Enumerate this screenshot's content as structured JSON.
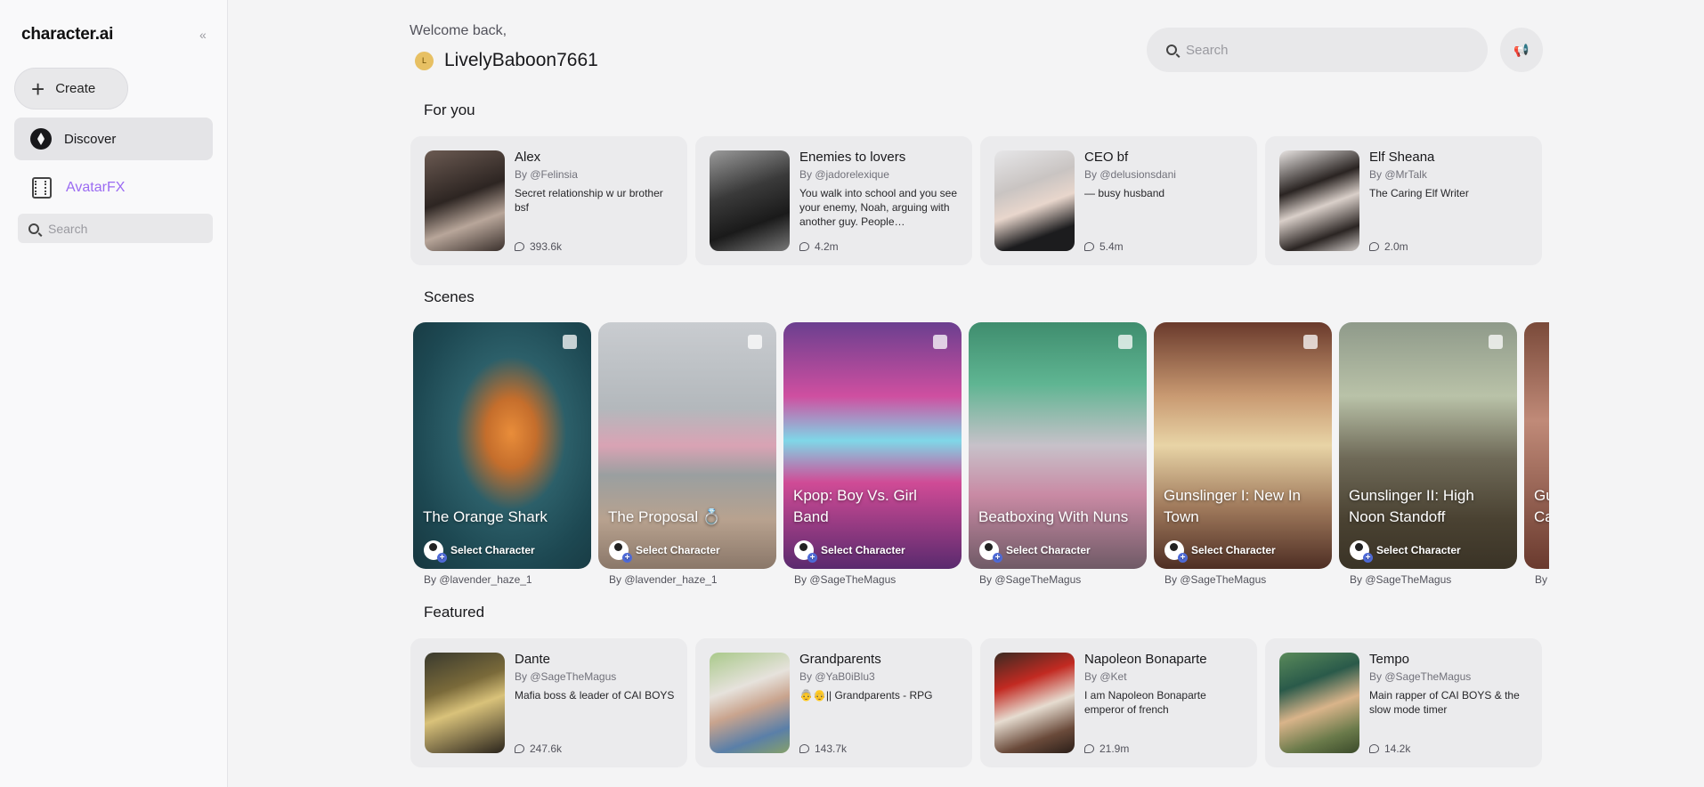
{
  "app": {
    "logo": "character.ai",
    "collapse_icon": "«"
  },
  "sidebar": {
    "create_label": "Create",
    "discover_label": "Discover",
    "avatarfx_label": "AvatarFX",
    "search_placeholder": "Search"
  },
  "header": {
    "welcome": "Welcome back,",
    "user_initial": "L",
    "username": "LivelyBaboon7661",
    "search_placeholder": "Search"
  },
  "sections": {
    "for_you": "For you",
    "scenes": "Scenes",
    "featured": "Featured"
  },
  "for_you": [
    {
      "name": "Alex",
      "by": "By @Felinsia",
      "desc": "Secret relationship w ur brother bsf",
      "count": "393.6k"
    },
    {
      "name": "Enemies to lovers",
      "by": "By @jadorelexique",
      "desc": "You walk into school and you see your enemy, Noah, arguing with another guy. People…",
      "count": "4.2m"
    },
    {
      "name": "CEO bf",
      "by": "By @delusionsdani",
      "desc": "— busy husband",
      "count": "5.4m"
    },
    {
      "name": "Elf Sheana",
      "by": "By @MrTalk",
      "desc": "The Caring Elf Writer",
      "count": "2.0m"
    }
  ],
  "scenes": [
    {
      "title": "The Orange Shark",
      "select": "Select Character",
      "by": "By @lavender_haze_1"
    },
    {
      "title": "The Proposal 💍",
      "select": "Select Character",
      "by": "By @lavender_haze_1"
    },
    {
      "title": "Kpop: Boy Vs. Girl Band",
      "select": "Select Character",
      "by": "By @SageTheMagus"
    },
    {
      "title": "Beatboxing With Nuns",
      "select": "Select Character",
      "by": "By @SageTheMagus"
    },
    {
      "title": "Gunslinger I: New In Town",
      "select": "Select Character",
      "by": "By @SageTheMagus"
    },
    {
      "title": "Gunslinger II: High Noon Standoff",
      "select": "Select Character",
      "by": "By @SageTheMagus"
    },
    {
      "title": "Gu Ca",
      "select": "",
      "by": "By"
    }
  ],
  "featured": [
    {
      "name": "Dante",
      "by": "By @SageTheMagus",
      "desc": "Mafia boss & leader of CAI BOYS",
      "count": "247.6k"
    },
    {
      "name": "Grandparents",
      "by": "By @YaB0iBlu3",
      "desc": "👵👴|| Grandparents - RPG",
      "count": "143.7k"
    },
    {
      "name": "Napoleon Bonaparte",
      "by": "By @Ket",
      "desc": "I am Napoleon Bonaparte emperor of french",
      "count": "21.9m"
    },
    {
      "name": "Tempo",
      "by": "By @SageTheMagus",
      "desc": "Main rapper of CAI BOYS & the slow mode timer",
      "count": "14.2k"
    }
  ]
}
